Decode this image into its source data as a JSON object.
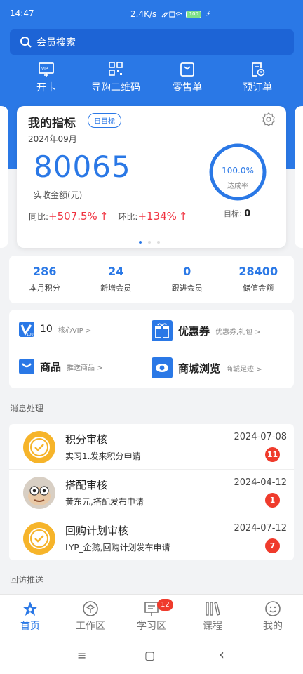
{
  "statusbar": {
    "time": "14:47",
    "network": "2.4K/s",
    "battery": "100"
  },
  "search": {
    "placeholder": "会员搜索"
  },
  "quick_actions": [
    {
      "label": "开卡",
      "icon": "vip-card-icon"
    },
    {
      "label": "导购二维码",
      "icon": "qr-code-icon"
    },
    {
      "label": "零售单",
      "icon": "shopping-bag-icon"
    },
    {
      "label": "预订单",
      "icon": "order-clock-icon"
    }
  ],
  "indicator": {
    "title": "我的指标",
    "tag": "日目标",
    "month": "2024年09月",
    "amount": "80065",
    "amount_label": "实收金额(元)",
    "yoy_label": "同比:",
    "yoy_value": "+507.5%",
    "mom_label": "环比:",
    "mom_value": "+134%",
    "arrow": "↑",
    "rate": "100.0%",
    "rate_label": "达成率",
    "rate_fraction": 1.0,
    "target_label": "目标:",
    "target_value": "0"
  },
  "stats": [
    {
      "value": "286",
      "label": "本月积分"
    },
    {
      "value": "24",
      "label": "新增会员"
    },
    {
      "value": "0",
      "label": "跟进会员"
    },
    {
      "value": "28400",
      "label": "储值金额"
    }
  ],
  "links": {
    "vip": {
      "count": "10",
      "sub": "核心VIP >"
    },
    "coupon": {
      "label": "优惠券",
      "sub": "优惠券,礼包 >"
    },
    "goods": {
      "label": "商品",
      "sub": "推送商品 >"
    },
    "mall": {
      "label": "商城浏览",
      "sub": "商城足迹 >"
    }
  },
  "sections": {
    "messages": "消息处理",
    "followup": "回访推送"
  },
  "messages": [
    {
      "name": "积分审核",
      "desc": "实习1.发来积分申请",
      "date": "2024-07-08",
      "count": "11"
    },
    {
      "name": "搭配审核",
      "desc": "黄东元,搭配发布申请",
      "date": "2024-04-12",
      "count": "1"
    },
    {
      "name": "回购计划审核",
      "desc": "LYP_企鹅,回购计划发布申请",
      "date": "2024-07-12",
      "count": "7"
    }
  ],
  "tabs": [
    {
      "label": "首页",
      "icon": "home-icon"
    },
    {
      "label": "工作区",
      "icon": "workspace-icon"
    },
    {
      "label": "学习区",
      "icon": "study-icon",
      "badge": "12"
    },
    {
      "label": "课程",
      "icon": "course-icon"
    },
    {
      "label": "我的",
      "icon": "profile-icon"
    }
  ],
  "navbar": {
    "menu": "≡",
    "home": "▢",
    "back": "‹"
  },
  "colors": {
    "primary": "#2a78e6",
    "red": "#f0313f",
    "badge": "#ef3b2c"
  }
}
